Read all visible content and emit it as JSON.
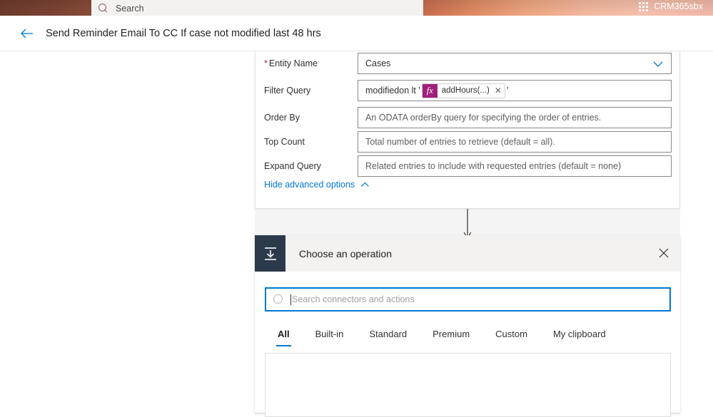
{
  "topbar": {
    "search": {
      "icon": "search-icon",
      "placeholder": "Search"
    },
    "environment": {
      "icon": "grid-icon",
      "label": "CRM365sbx"
    }
  },
  "commandbar": {
    "back_icon": "arrow-left-icon",
    "flow_title": "Send Reminder Email To CC If case not modified last 48 hrs"
  },
  "action_card": {
    "fields": [
      {
        "label": "Entity Name",
        "required": true,
        "value": "Cases",
        "placeholder": "",
        "type": "dropdown",
        "icon": "chevron-down-icon"
      },
      {
        "label": "Filter Query",
        "required": false,
        "value_prefix": "modifiedon lt '",
        "token_label": "addHours(...)",
        "token_icon": "fx-icon",
        "token_close_icon": "close-icon",
        "value_suffix": "'",
        "placeholder": "",
        "type": "token"
      },
      {
        "label": "Order By",
        "required": false,
        "value": "",
        "placeholder": "An ODATA orderBy query for specifying the order of entries.",
        "type": "text"
      },
      {
        "label": "Top Count",
        "required": false,
        "value": "",
        "placeholder": "Total number of entries to retrieve (default = all).",
        "type": "text"
      },
      {
        "label": "Expand Query",
        "required": false,
        "value": "",
        "placeholder": "Related entries to include with requested entries (default = none)",
        "type": "text"
      }
    ],
    "advanced_options_link": {
      "label": "Hide advanced options",
      "icon": "chevron-up-icon"
    }
  },
  "connector": {
    "icon": "arrow-down-icon"
  },
  "operation_panel": {
    "icon": "insert-step-icon",
    "title": "Choose an operation",
    "close_icon": "close-icon",
    "search": {
      "icon": "search-icon",
      "placeholder": "Search connectors and actions",
      "value": ""
    },
    "tabs": [
      {
        "label": "All",
        "active": true
      },
      {
        "label": "Built-in",
        "active": false
      },
      {
        "label": "Standard",
        "active": false
      },
      {
        "label": "Premium",
        "active": false
      },
      {
        "label": "Custom",
        "active": false
      },
      {
        "label": "My clipboard",
        "active": false
      }
    ]
  },
  "colors": {
    "accent": "#0078d4",
    "required": "#a4262c",
    "token_fx": "#a01f7c",
    "panel_header": "#f3f2f1",
    "canvas": "#f4f4f4"
  }
}
